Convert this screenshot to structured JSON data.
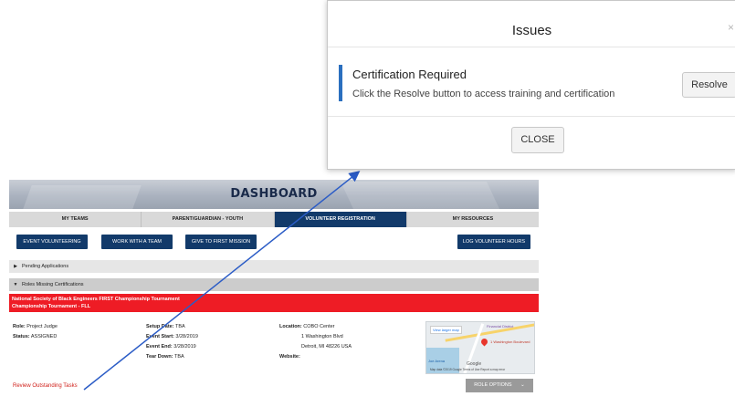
{
  "modal": {
    "title": "Issues",
    "close_glyph": "×",
    "issue": {
      "heading": "Certification Required",
      "description": "Click the Resolve button to access training and certification"
    },
    "resolve_label": "Resolve",
    "close_label": "CLOSE",
    "accent_color": "#2b6fbf"
  },
  "dashboard": {
    "title": "DASHBOARD",
    "tabs": [
      "MY TEAMS",
      "PARENT/GUARDIAN - YOUTH",
      "VOLUNTEER REGISTRATION",
      "MY RESOURCES"
    ],
    "active_tab": "VOLUNTEER REGISTRATION",
    "buttons": {
      "event_volunteering": "EVENT VOLUNTEERING",
      "work_with_team": "WORK WITH A TEAM",
      "give_to_first": "GIVE TO FIRST MISSION",
      "log_hours": "LOG VOLUNTEER HOURS"
    },
    "sections": {
      "pending": "Pending Applications",
      "roles_missing": "Roles Missing Certifications"
    },
    "event": {
      "name_line1": "National Society of Black Engineers FIRST Championship Tournament",
      "name_line2": "Championship Tournament - FLL",
      "role_label": "Role:",
      "role_value": "Project Judge",
      "status_label": "Status:",
      "status_value": "ASSIGNED",
      "setup_label": "Setup Date:",
      "setup_value": "TBA",
      "start_label": "Event Start:",
      "start_value": "3/28/2019",
      "end_label": "Event End:",
      "end_value": "3/28/2019",
      "teardown_label": "Tear Down:",
      "teardown_value": "TBA",
      "location_label": "Location:",
      "location_value": "COBO Center",
      "address1": "1 Washington Blvd",
      "address2": "Detroit, MI 48226 USA",
      "website_label": "Website:"
    },
    "map": {
      "view_larger": "View larger map",
      "district": "Financial District",
      "place": "1 Washington Boulevard",
      "arena": "Joe Arena",
      "google": "Google",
      "footer": "Map data ©2019 Google   Terms of Use   Report a map error"
    },
    "role_options": "ROLE OPTIONS",
    "role_options_icon": "chevron-down-icon",
    "review_link": "Review Outstanding Tasks",
    "colors": {
      "navy": "#123a6a",
      "red": "#ee1c25",
      "link_red": "#d0211b",
      "arrow_blue": "#2b5cc6"
    }
  }
}
